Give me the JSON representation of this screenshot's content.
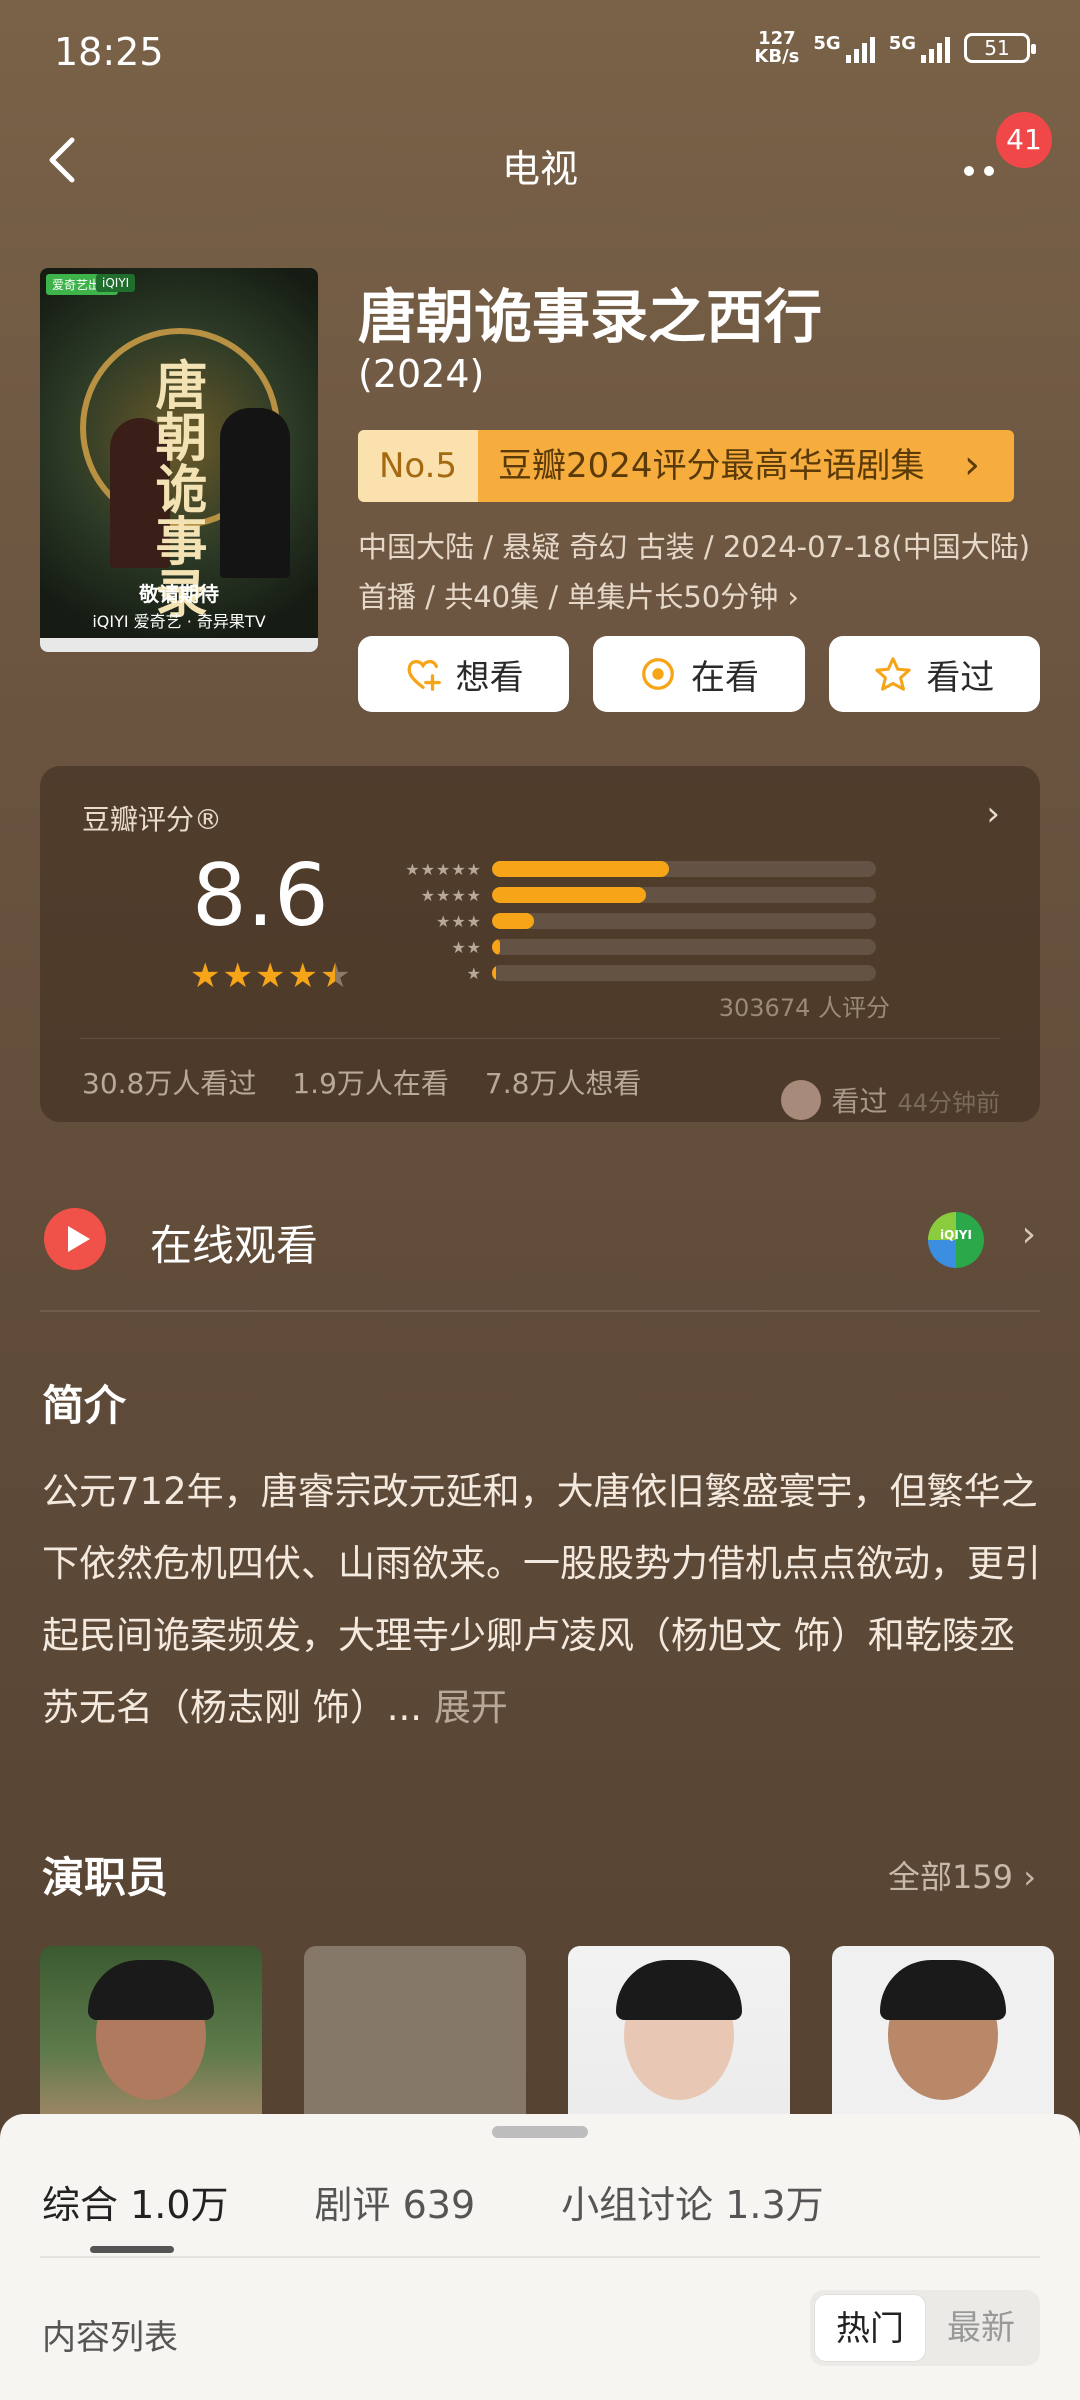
{
  "status_bar": {
    "time": "18:25",
    "net_speed_value": "127",
    "net_speed_unit": "KB/s",
    "signal1_label": "5G",
    "signal2_label": "5G",
    "battery": "51"
  },
  "nav": {
    "title": "电视",
    "badge_count": "41"
  },
  "header": {
    "poster": {
      "tag1": "爱奇艺出品",
      "tag2": "iQIYI",
      "calligraphy": "唐朝诡事录",
      "caption": "敬请期待",
      "platforms": "iQIYI 爱奇艺 · 奇异果TV"
    },
    "title": "唐朝诡事录之西行",
    "year": "(2024)",
    "rank_no": "No.5",
    "rank_text": "豆瓣2024评分最高华语剧集",
    "meta": "中国大陆 / 悬疑 奇幻 古装 / 2024-07-18(中国大陆)首播 / 共40集 / 单集片长50分钟 ›"
  },
  "actions": [
    {
      "label": "想看",
      "icon": "heart-plus-icon"
    },
    {
      "label": "在看",
      "icon": "target-icon"
    },
    {
      "label": "看过",
      "icon": "star-outline-icon"
    }
  ],
  "rating": {
    "label": "豆瓣评分®",
    "score": "8.6",
    "stars": 4.5,
    "distribution_percent": [
      46,
      40,
      11,
      2,
      1
    ],
    "votes_text": "303674 人评分",
    "stats": [
      "30.8万人看过",
      "1.9万人在看",
      "7.8万人想看"
    ],
    "seen_label": "看过",
    "seen_time": "44分钟前",
    "accent_color": "#f6a418"
  },
  "online": {
    "label": "在线观看",
    "platform_icon": "iqiyi-icon"
  },
  "intro": {
    "title": "简介",
    "body": "公元712年，唐睿宗改元延和，大唐依旧繁盛寰宇，但繁华之下依然危机四伏、山雨欲来。一股股势力借机点点欲动，更引起民间诡案频发，大理寺少卿卢凌风（杨旭文 饰）和乾陵丞苏无名（杨志刚 饰）... ",
    "expand": "展开"
  },
  "cast": {
    "title": "演职员",
    "all_label": "全部159 ›"
  },
  "sheet": {
    "tabs": [
      "综合 1.0万",
      "剧评 639",
      "小组讨论 1.3万"
    ],
    "list_label": "内容列表",
    "sort_options": [
      "热门",
      "最新"
    ],
    "sort_selected": "热门"
  }
}
